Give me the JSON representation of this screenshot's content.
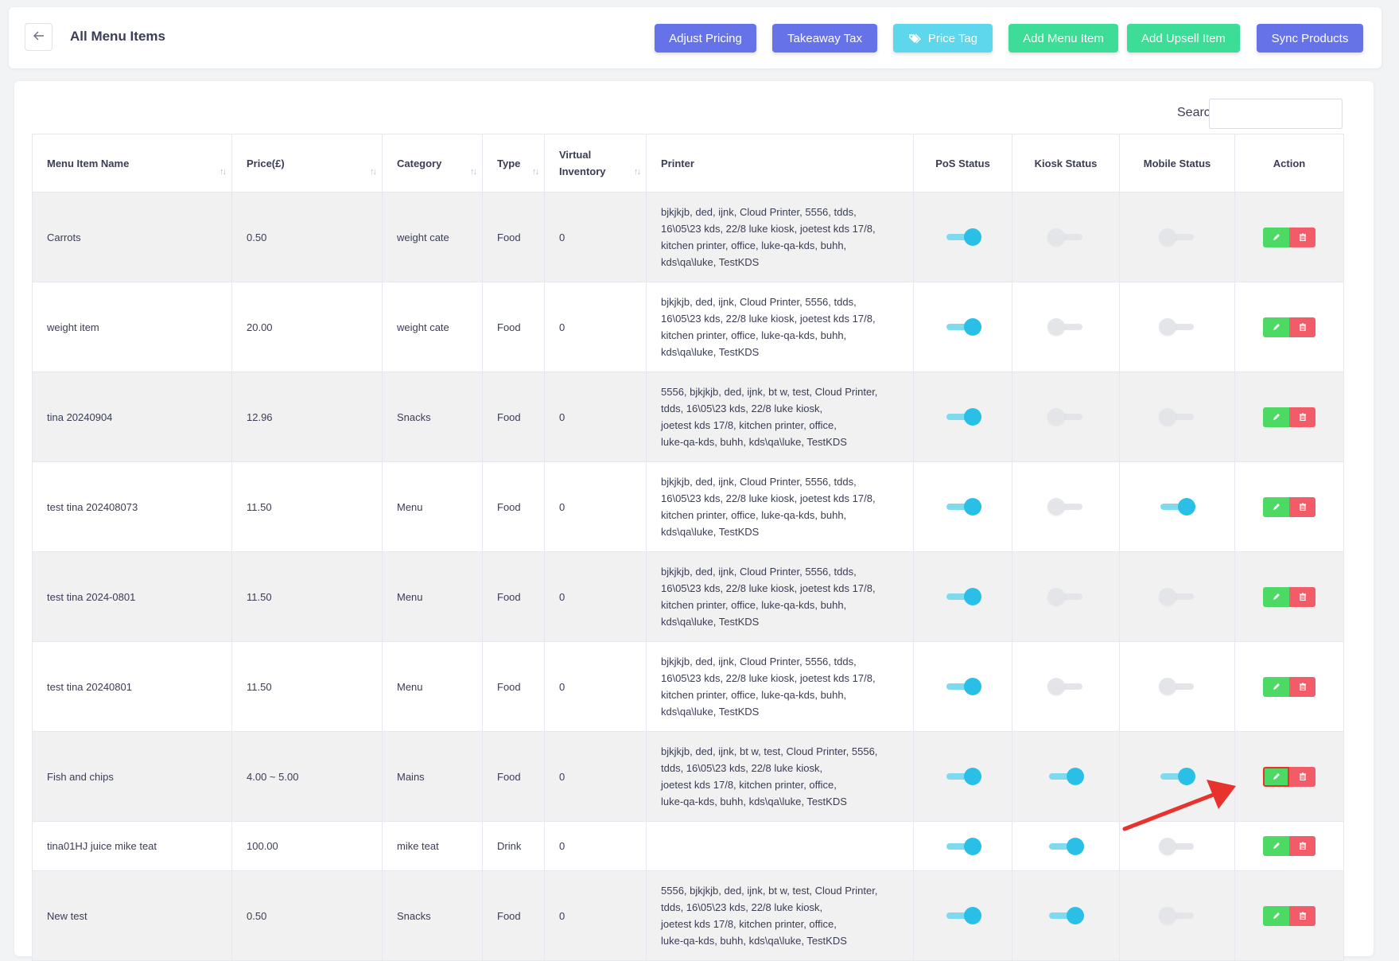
{
  "header": {
    "title": "All Menu Items",
    "buttons": {
      "adjust_pricing": "Adjust Pricing",
      "takeaway_tax": "Takeaway Tax",
      "price_tag": "Price Tag",
      "add_menu_item": "Add Menu Item",
      "add_upsell_item": "Add Upsell Item",
      "sync_products": "Sync Products"
    }
  },
  "colors": {
    "indigo": "#6673e8",
    "cyan": "#5ed6ec",
    "green": "#3ddc97",
    "edit": "#4cd964",
    "delete": "#f25c68",
    "toggle_on": "#29bfe6",
    "annotation": "#e8322d"
  },
  "search": {
    "label": "Search:",
    "value": ""
  },
  "table": {
    "columns": {
      "name": "Menu Item Name",
      "price": "Price(£)",
      "category": "Category",
      "type": "Type",
      "virtual_inventory": "Virtual Inventory",
      "printer": "Printer",
      "pos_status": "PoS Status",
      "kiosk_status": "Kiosk Status",
      "mobile_status": "Mobile Status",
      "action": "Action"
    },
    "rows": [
      {
        "name": "Carrots",
        "price": "0.50",
        "category": "weight cate",
        "type": "Food",
        "vi": "0",
        "printer": [
          "bjkjkjb, ded, ijnk, Cloud Printer, 5556, tdds,",
          "16\\05\\23 kds, 22/8 luke kiosk, joetest kds 17/8,",
          "kitchen printer, office, luke-qa-kds, buhh,",
          "kds\\qa\\luke, TestKDS"
        ]
      },
      {
        "name": "weight item",
        "price": "20.00",
        "category": "weight cate",
        "type": "Food",
        "vi": "0",
        "printer": [
          "bjkjkjb, ded, ijnk, Cloud Printer, 5556, tdds,",
          "16\\05\\23 kds, 22/8 luke kiosk, joetest kds 17/8,",
          "kitchen printer, office, luke-qa-kds, buhh,",
          "kds\\qa\\luke, TestKDS"
        ]
      },
      {
        "name": "tina 20240904",
        "price": "12.96",
        "category": "Snacks",
        "type": "Food",
        "vi": "0",
        "printer": [
          "5556, bjkjkjb, ded, ijnk, bt w, test, Cloud Printer,",
          "tdds, 16\\05\\23 kds, 22/8 luke kiosk,",
          "joetest kds 17/8, kitchen printer, office,",
          "luke-qa-kds, buhh, kds\\qa\\luke, TestKDS"
        ]
      },
      {
        "name": "test tina 202408073",
        "price": "11.50",
        "category": "Menu",
        "type": "Food",
        "vi": "0",
        "printer": [
          "bjkjkjb, ded, ijnk, Cloud Printer, 5556, tdds,",
          "16\\05\\23 kds, 22/8 luke kiosk, joetest kds 17/8,",
          "kitchen printer, office, luke-qa-kds, buhh,",
          "kds\\qa\\luke, TestKDS"
        ]
      },
      {
        "name": "test tina 2024-0801",
        "price": "11.50",
        "category": "Menu",
        "type": "Food",
        "vi": "0",
        "printer": [
          "bjkjkjb, ded, ijnk, Cloud Printer, 5556, tdds,",
          "16\\05\\23 kds, 22/8 luke kiosk, joetest kds 17/8,",
          "kitchen printer, office, luke-qa-kds, buhh,",
          "kds\\qa\\luke, TestKDS"
        ]
      },
      {
        "name": "test tina 20240801",
        "price": "11.50",
        "category": "Menu",
        "type": "Food",
        "vi": "0",
        "printer": [
          "bjkjkjb, ded, ijnk, Cloud Printer, 5556, tdds,",
          "16\\05\\23 kds, 22/8 luke kiosk, joetest kds 17/8,",
          "kitchen printer, office, luke-qa-kds, buhh,",
          "kds\\qa\\luke, TestKDS"
        ]
      },
      {
        "name": "Fish and chips",
        "price": "4.00 ~ 5.00",
        "category": "Mains",
        "type": "Food",
        "vi": "0",
        "printer": [
          "bjkjkjb, ded, ijnk, bt w, test, Cloud Printer, 5556,",
          "tdds, 16\\05\\23 kds, 22/8 luke kiosk,",
          "joetest kds 17/8, kitchen printer, office,",
          "luke-qa-kds, buhh, kds\\qa\\luke, TestKDS"
        ]
      },
      {
        "name": "tina01HJ juice mike teat",
        "price": "100.00",
        "category": "mike teat",
        "type": "Drink",
        "vi": "0",
        "printer": []
      },
      {
        "name": "New test",
        "price": "0.50",
        "category": "Snacks",
        "type": "Food",
        "vi": "0",
        "printer": [
          "5556, bjkjkjb, ded, ijnk, bt w, test, Cloud Printer,",
          "tdds, 16\\05\\23 kds, 22/8 luke kiosk,",
          "joetest kds 17/8, kitchen printer, office,",
          "luke-qa-kds, buhh, kds\\qa\\luke, TestKDS"
        ]
      }
    ]
  }
}
